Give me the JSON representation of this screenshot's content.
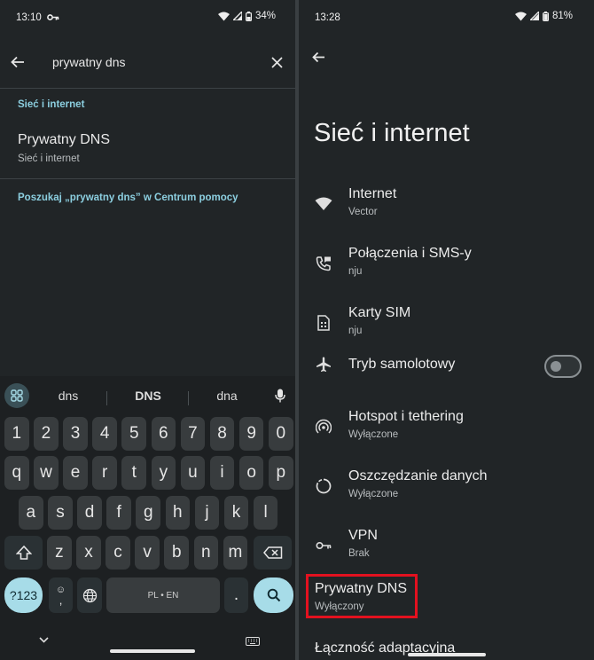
{
  "left": {
    "status": {
      "time": "13:10",
      "battery": "34%"
    },
    "search": {
      "query": "prywatny dns"
    },
    "section_label": "Sieć i internet",
    "result": {
      "title": "Prywatny DNS",
      "subtitle": "Sieć i internet"
    },
    "help_link": "Poszukaj „prywatny dns” w Centrum pomocy",
    "keyboard": {
      "suggestions": [
        "dns",
        "DNS",
        "dna"
      ],
      "row_numbers": [
        "1",
        "2",
        "3",
        "4",
        "5",
        "6",
        "7",
        "8",
        "9",
        "0"
      ],
      "row_top": [
        "q",
        "w",
        "e",
        "r",
        "t",
        "y",
        "u",
        "i",
        "o",
        "p"
      ],
      "row_mid": [
        "a",
        "s",
        "d",
        "f",
        "g",
        "h",
        "j",
        "k",
        "l"
      ],
      "row_bottom": [
        "z",
        "x",
        "c",
        "v",
        "b",
        "n",
        "m"
      ],
      "symbols_label": "?123",
      "emoji_comma": ",",
      "space_label": "PL • EN",
      "period": "."
    }
  },
  "right": {
    "status": {
      "time": "13:28",
      "battery": "81%"
    },
    "title": "Sieć i internet",
    "items": [
      {
        "title": "Internet",
        "subtitle": "Vector",
        "icon": "wifi-icon"
      },
      {
        "title": "Połączenia i SMS-y",
        "subtitle": "nju",
        "icon": "calls-sms-icon"
      },
      {
        "title": "Karty SIM",
        "subtitle": "nju",
        "icon": "sim-card-icon"
      },
      {
        "title": "Tryb samolotowy",
        "subtitle": "",
        "icon": "airplane-icon",
        "toggle": false
      },
      {
        "title": "Hotspot i tethering",
        "subtitle": "Wyłączone",
        "icon": "hotspot-icon"
      },
      {
        "title": "Oszczędzanie danych",
        "subtitle": "Wyłączone",
        "icon": "data-saver-icon"
      },
      {
        "title": "VPN",
        "subtitle": "Brak",
        "icon": "vpn-key-icon"
      }
    ],
    "private_dns": {
      "title": "Prywatny DNS",
      "subtitle": "Wyłączony"
    },
    "adaptive": "Łączność adaptacyjna"
  },
  "colors": {
    "accent": "#8ccfe0",
    "highlight": "#e3111f",
    "background": "#212527"
  }
}
